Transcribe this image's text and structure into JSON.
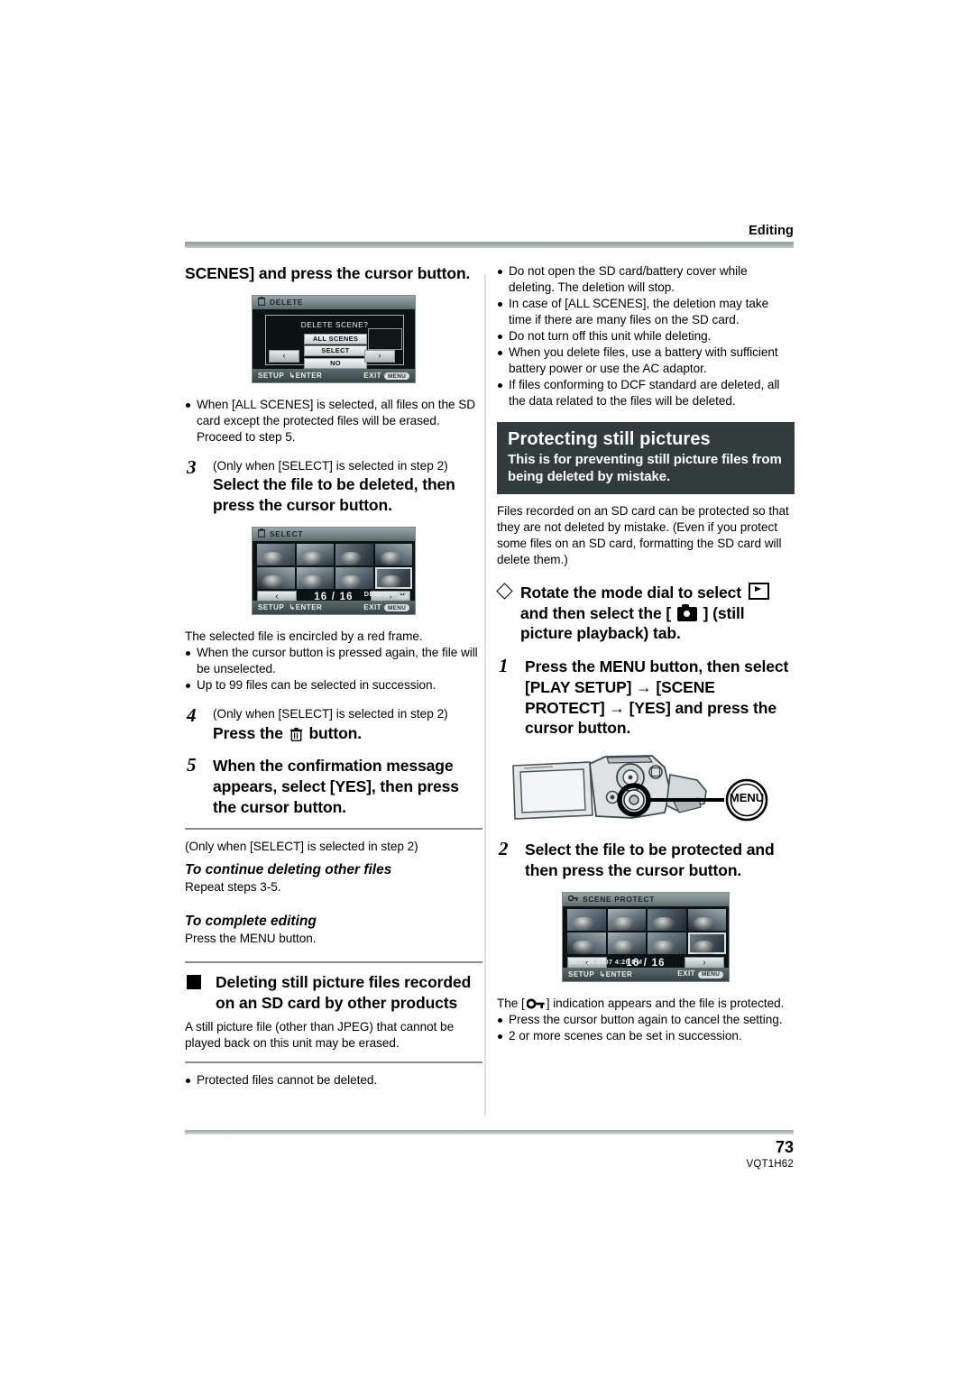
{
  "running_head": "Editing",
  "footer": {
    "page_number": "73",
    "doc_code": "VQT1H62"
  },
  "left_column": {
    "heading_continued": "SCENES] and press the cursor button.",
    "figure_delete": {
      "title": "DELETE",
      "question": "DELETE SCENE?",
      "options": [
        "ALL SCENES",
        "SELECT",
        "NO"
      ],
      "prev_arrow": "‹",
      "next_arrow": "›",
      "footer_left": "SETUP",
      "footer_enter": "ENTER",
      "footer_exit": "EXIT",
      "footer_exit_pill": "MENU"
    },
    "note_all_scenes": "When [ALL SCENES] is selected, all files on the SD card except the protected files will be erased. Proceed to step 5.",
    "step3": {
      "number": "3",
      "condition": "(Only when [SELECT] is selected in step 2)",
      "text": "Select the file to be deleted, then press the cursor button."
    },
    "figure_select": {
      "title": "SELECT",
      "count": "16 / 16",
      "prev_arrow": "‹",
      "next_arrow": "›",
      "delete_hint": "DELETE",
      "delete_pill": "••",
      "footer_left": "SETUP",
      "footer_enter": "ENTER",
      "footer_exit": "EXIT",
      "footer_exit_pill": "MENU"
    },
    "after_select_text": "The selected file is encircled by a red frame.",
    "after_select_bullets": [
      "When the cursor button is pressed again, the file will be unselected.",
      "Up to 99 files can be selected in succession."
    ],
    "step4": {
      "number": "4",
      "condition": "(Only when [SELECT] is selected in step 2)",
      "text_before_icon": "Press the",
      "icon": "trash-icon",
      "text_after_icon": "button."
    },
    "step5": {
      "number": "5",
      "text": "When the confirmation message appears, select [YES], then press the cursor button."
    },
    "continue_block": {
      "condition": "(Only when [SELECT] is selected in step 2)",
      "heading": "To continue deleting other files",
      "text": "Repeat steps 3-5."
    },
    "complete_block": {
      "heading": "To complete editing",
      "text": "Press the MENU button."
    },
    "deleting_section": {
      "heading": "Deleting still picture files recorded on an SD card by other products",
      "body": "A still picture file (other than JPEG) that cannot be played back on this unit may be erased.",
      "bullets": [
        "Protected files cannot be deleted."
      ]
    }
  },
  "right_column": {
    "delete_cautions": [
      "Do not open the SD card/battery cover while deleting. The deletion will stop.",
      "In case of [ALL SCENES], the deletion may take time if there are many files on the SD card.",
      "Do not turn off this unit while deleting.",
      "When you delete files, use a battery with sufficient battery power or use the AC adaptor.",
      "If files conforming to DCF standard are deleted, all the data related to the files will be deleted."
    ],
    "banner": {
      "title": "Protecting still pictures",
      "subtitle": "This is for preventing still picture files from being deleted by mistake."
    },
    "intro": "Files recorded on an SD card can be protected so that they are not deleted by mistake. (Even if you protect some files on an SD card, formatting the SD card will delete them.)",
    "mode_dial": {
      "text_1": "Rotate the mode dial to select",
      "icon_1": "play-icon",
      "text_2": "and then select the [",
      "icon_2": "still-camera-icon",
      "text_3": "] (still picture playback) tab."
    },
    "step1": {
      "number": "1",
      "text": "Press the MENU button, then select [PLAY SETUP] → [SCENE PROTECT] → [YES] and press the cursor button."
    },
    "camcorder_figure": {
      "callout_label": "MENU"
    },
    "step2": {
      "number": "2",
      "text": "Select the file to be protected and then press the cursor button."
    },
    "figure_scene_protect": {
      "title": "SCENE PROTECT",
      "count": "16 / 16",
      "prev_arrow": "‹",
      "next_arrow": "›",
      "date": "DEC 15 2007  4:26 PM",
      "footer_left": "SETUP",
      "footer_enter": "ENTER",
      "footer_exit": "EXIT",
      "footer_exit_pill": "MENU"
    },
    "after_protect_text_1": "The [",
    "after_protect_icon": "key-icon",
    "after_protect_text_2": "] indication appears and the file is protected.",
    "after_protect_bullets": [
      "Press the cursor button again to cancel the setting.",
      "2 or more scenes can be set in succession."
    ]
  },
  "colors": {
    "banner_bg": "#323c3c",
    "rule_top": "#9aa8a4",
    "divider": "#d9e0de"
  }
}
